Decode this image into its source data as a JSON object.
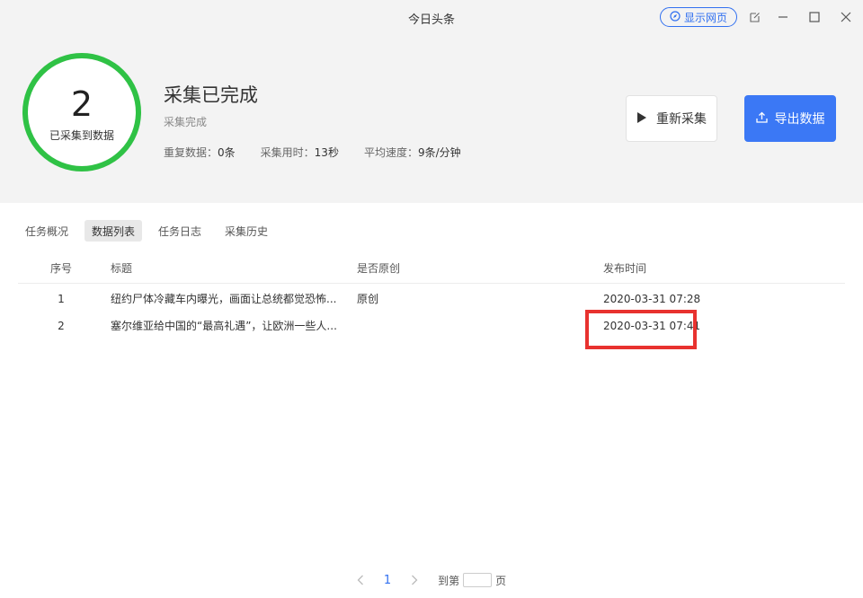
{
  "window": {
    "title": "今日头条",
    "show_web_label": "显示网页"
  },
  "summary": {
    "collected_count": "2",
    "collected_label": "已采集到数据",
    "status_title": "采集已完成",
    "status_sub": "采集完成",
    "stats": [
      {
        "label": "重复数据：",
        "value": "0条"
      },
      {
        "label": "采集用时：",
        "value": "13秒"
      },
      {
        "label": "平均速度：",
        "value": "9条/分钟"
      }
    ],
    "progress": 1.0,
    "ring_color": "#2fc245"
  },
  "actions": {
    "restart_label": "重新采集",
    "export_label": "导出数据",
    "export_color": "#3b78f5"
  },
  "tabs": [
    {
      "label": "任务概况",
      "active": false
    },
    {
      "label": "数据列表",
      "active": true
    },
    {
      "label": "任务日志",
      "active": false
    },
    {
      "label": "采集历史",
      "active": false
    }
  ],
  "table": {
    "headers": {
      "seq": "序号",
      "title": "标题",
      "original": "是否原创",
      "time": "发布时间"
    },
    "rows": [
      {
        "seq": "1",
        "title": "纽约尸体冷藏车内曝光，画面让总统都觉恐怖...",
        "original": "原创",
        "time": "2020-03-31 07:28"
      },
      {
        "seq": "2",
        "title": "塞尔维亚给中国的“最高礼遇”，让欧洲一些人...",
        "original": "",
        "time": "2020-03-31 07:41"
      }
    ]
  },
  "pagination": {
    "current_page": "1",
    "goto_label": "到第",
    "page_suffix": "页",
    "goto_value": ""
  },
  "highlight_color": "#e8322f"
}
